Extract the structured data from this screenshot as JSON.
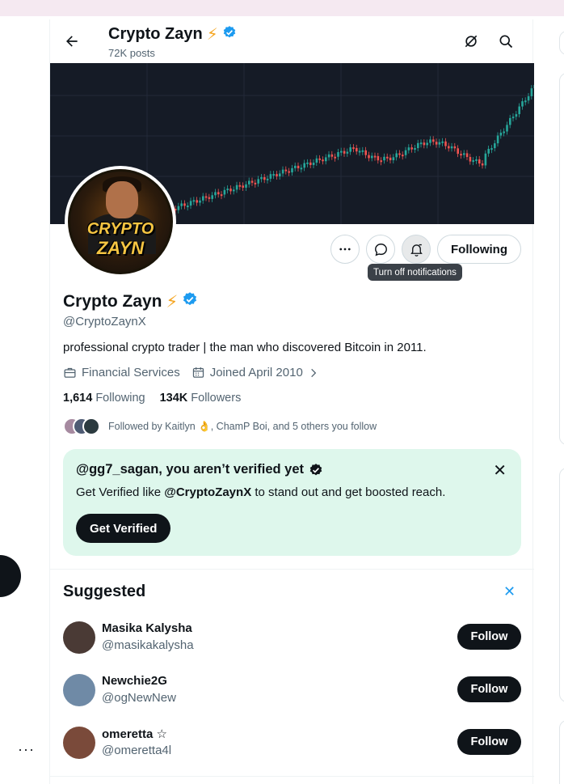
{
  "header": {
    "title": "Crypto Zayn",
    "title_emoji": "⚡",
    "posts_count": "72K posts"
  },
  "avatar": {
    "text_line1": "CRYPTO",
    "text_line2": "ZAYN"
  },
  "actions": {
    "following_label": "Following",
    "tooltip": "Turn off notifications"
  },
  "profile": {
    "name": "Crypto Zayn",
    "name_emoji": "⚡",
    "handle": "@CryptoZaynX",
    "bio": "professional crypto trader | the man who discovered Bitcoin in 2011.",
    "category": "Financial Services",
    "joined": "Joined April 2010",
    "following_count": "1,614",
    "following_label": "Following",
    "followers_count": "134K",
    "followers_label": "Followers",
    "followed_by": "Followed by Kaitlyn 👌, ChamP Boi, and 5 others you follow"
  },
  "verify_card": {
    "title": "@gg7_sagan, you aren’t verified yet",
    "body_prefix": "Get Verified like ",
    "body_handle": "@CryptoZaynX",
    "body_suffix": " to stand out and get boosted reach.",
    "button": "Get Verified",
    "close": "✕"
  },
  "suggested": {
    "title": "Suggested",
    "close": "✕",
    "items": [
      {
        "name": "Masika Kalysha",
        "handle": "@masikakalysha",
        "button": "Follow",
        "avatar_color": "#4a3a35"
      },
      {
        "name": "Newchie2G",
        "handle": "@ogNewNew",
        "button": "Follow",
        "avatar_color": "#6f8aa6"
      },
      {
        "name": "omeretta ☆",
        "handle": "@omeretta4l",
        "button": "Follow",
        "avatar_color": "#7a4a3a"
      }
    ]
  },
  "left_nav": {
    "more": "···"
  },
  "colors": {
    "accent": "#1d9bf0",
    "verify_bg": "#def7ec",
    "banner_bg": "#151b26",
    "candle_up": "#26a69a",
    "candle_down": "#ef5350"
  }
}
